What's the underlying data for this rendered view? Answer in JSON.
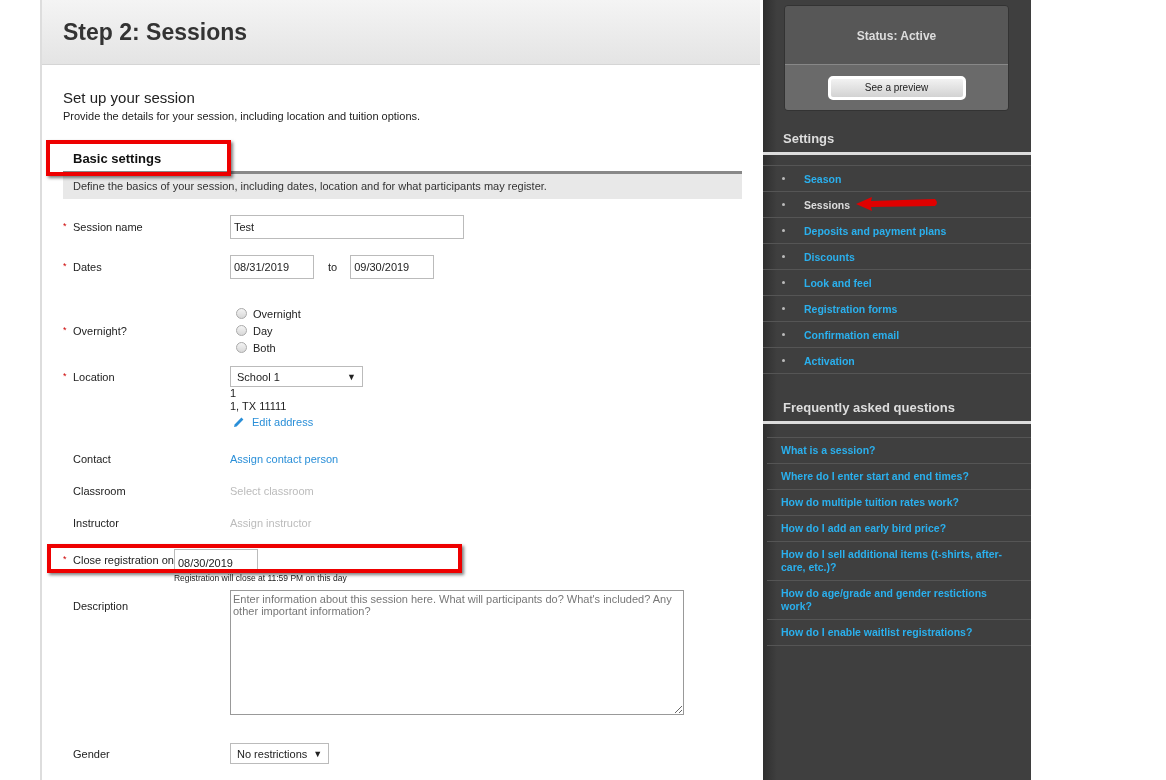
{
  "page_title": "Step 2: Sessions",
  "intro": {
    "heading": "Set up your session",
    "text": "Provide the details for your session, including location and tuition options."
  },
  "section": {
    "heading": "Basic settings",
    "highlighted": true,
    "description": "Define the basics of your session, including dates, location and for what participants may register."
  },
  "fields": [
    {
      "kind": "text",
      "label": "Session name",
      "required_mark": "*",
      "value": "Test",
      "highlighted": false
    },
    {
      "kind": "daterange",
      "label": "Dates",
      "required_mark": "*",
      "start": "08/31/2019",
      "separator": "to",
      "end": "09/30/2019",
      "highlighted": false
    },
    {
      "kind": "radio",
      "label": "Overnight?",
      "required_mark": "*",
      "highlighted": false,
      "options": [
        {
          "label": "Overnight",
          "selected": false
        },
        {
          "label": "Day",
          "selected": false
        },
        {
          "label": "Both",
          "selected": false
        }
      ]
    },
    {
      "kind": "select",
      "label": "Location",
      "required_mark": "*",
      "value": "School 1",
      "caret": "▼",
      "highlighted": false,
      "address": [
        "1",
        "1, TX 11111"
      ],
      "link": "Edit address"
    },
    {
      "kind": "link",
      "label": "Contact",
      "value": "Assign contact person",
      "disabled": false,
      "highlighted": false
    },
    {
      "kind": "link",
      "label": "Classroom",
      "value": "Select classroom",
      "disabled": true,
      "highlighted": false
    },
    {
      "kind": "link",
      "label": "Instructor",
      "value": "Assign instructor",
      "disabled": true,
      "highlighted": false
    },
    {
      "kind": "date",
      "label": "Close registration on",
      "required_mark": "*",
      "value": "08/30/2019",
      "hint": "Registration will close at 11:59 PM on this day",
      "highlighted": true
    },
    {
      "kind": "textarea",
      "label": "Description",
      "placeholder": "Enter information about this session here. What will participants do? What's included? Any other important information?",
      "highlighted": false
    },
    {
      "kind": "select",
      "label": "Gender",
      "value": "No restrictions",
      "caret": "▼",
      "highlighted": false
    }
  ],
  "sidebar": {
    "status": "Status: Active",
    "preview_button": "See a preview",
    "settings_heading": "Settings",
    "settings": [
      {
        "label": "Season",
        "selected": false,
        "arrow": false
      },
      {
        "label": "Sessions",
        "selected": true,
        "arrow": true
      },
      {
        "label": "Deposits and payment plans",
        "selected": false,
        "arrow": false
      },
      {
        "label": "Discounts",
        "selected": false,
        "arrow": false
      },
      {
        "label": "Look and feel",
        "selected": false,
        "arrow": false
      },
      {
        "label": "Registration forms",
        "selected": false,
        "arrow": false
      },
      {
        "label": "Confirmation email",
        "selected": false,
        "arrow": false
      },
      {
        "label": "Activation",
        "selected": false,
        "arrow": false
      }
    ],
    "faq_heading": "Frequently asked questions",
    "faq": [
      "What is a session?",
      "Where do I enter start and end times?",
      "How do multiple tuition rates work?",
      "How do I add an early bird price?",
      "How do I sell additional items (t-shirts, after-care, etc.)?",
      "How do age/grade and gender restictions work?",
      "How do I enable waitlist registrations?"
    ]
  }
}
